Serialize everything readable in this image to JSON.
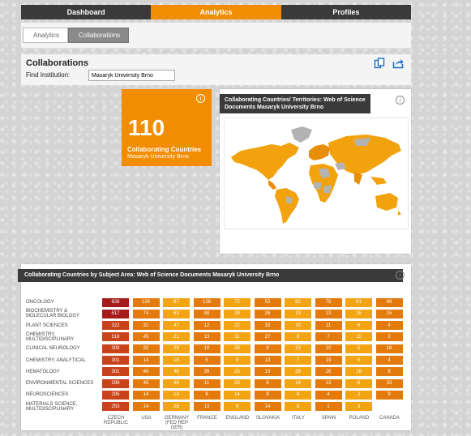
{
  "nav": {
    "tabs": [
      {
        "label": "Dashboard"
      },
      {
        "label": "Analytics"
      },
      {
        "label": "Profiles"
      }
    ]
  },
  "breadcrumb": [
    "Analytics",
    "Collaborations"
  ],
  "header": {
    "title": "Collaborations",
    "find_label": "Find Institution:",
    "find_value": "Masaryk University Brno"
  },
  "count_card": {
    "number": "110",
    "label": "Collaborating Countries",
    "sub": "Masaryk University Brno"
  },
  "map_card": {
    "title_line1": "Collaborating Countries/ Territories: Web of Science",
    "title_line2": "Documents Masaryk University Brno"
  },
  "table_card": {
    "title": "Collaborating Countries by Subject Area: Web of Science Documents Masaryk University Brno",
    "columns": [
      "CZECH REPUBLIC",
      "USA",
      "GERMANY (FED REP GER)",
      "FRANCE",
      "ENGLAND",
      "SLOVAKIA",
      "ITALY",
      "SPAIN",
      "POLAND",
      "CANADA"
    ],
    "rows": [
      {
        "label": "ONCOLOGY",
        "values": [
          "628",
          "134",
          "87",
          "128",
          "72",
          "53",
          "82",
          "78",
          "61",
          "49"
        ]
      },
      {
        "label": "BIOCHEMISTRY & MOLECULAR BIOLOGY",
        "values": [
          "517",
          "74",
          "63",
          "88",
          "28",
          "26",
          "19",
          "13",
          "15",
          "15"
        ]
      },
      {
        "label": "PLANT SCIENCES",
        "values": [
          "322",
          "31",
          "47",
          "12",
          "22",
          "33",
          "18",
          "11",
          "6",
          "4"
        ]
      },
      {
        "label": "CHEMISTRY, MULTIDISCIPLINARY",
        "values": [
          "318",
          "45",
          "21",
          "13",
          "11",
          "27",
          "8",
          "7",
          "11",
          "2"
        ]
      },
      {
        "label": "CLINICAL NEUROLOGY",
        "values": [
          "308",
          "32",
          "29",
          "10",
          "28",
          "9",
          "13",
          "10",
          "5",
          "18"
        ]
      },
      {
        "label": "CHEMISTRY, ANALYTICAL",
        "values": [
          "301",
          "14",
          "16",
          "5",
          "5",
          "13",
          "7",
          "19",
          "5",
          "4"
        ]
      },
      {
        "label": "HEMATOLOGY",
        "values": [
          "301",
          "40",
          "46",
          "39",
          "25",
          "13",
          "39",
          "26",
          "16",
          "8"
        ]
      },
      {
        "label": "ENVIRONMENTAL SCIENCES",
        "values": [
          "299",
          "45",
          "69",
          "11",
          "23",
          "6",
          "14",
          "13",
          "8",
          "33"
        ]
      },
      {
        "label": "NEUROSCIENCES",
        "values": [
          "295",
          "14",
          "13",
          "8",
          "14",
          "8",
          "9",
          "4",
          "2",
          "9"
        ]
      },
      {
        "label": "MATERIALS SCIENCE, MULTIDISCIPLINARY",
        "values": [
          "253",
          "14",
          "26",
          "13",
          "9",
          "14",
          "8",
          "1",
          "3",
          ""
        ]
      }
    ],
    "colors": {
      "dark": "#a61c1c",
      "high": "#c8421a",
      "mid": "#e37a0b",
      "low": "#f2a413"
    }
  }
}
